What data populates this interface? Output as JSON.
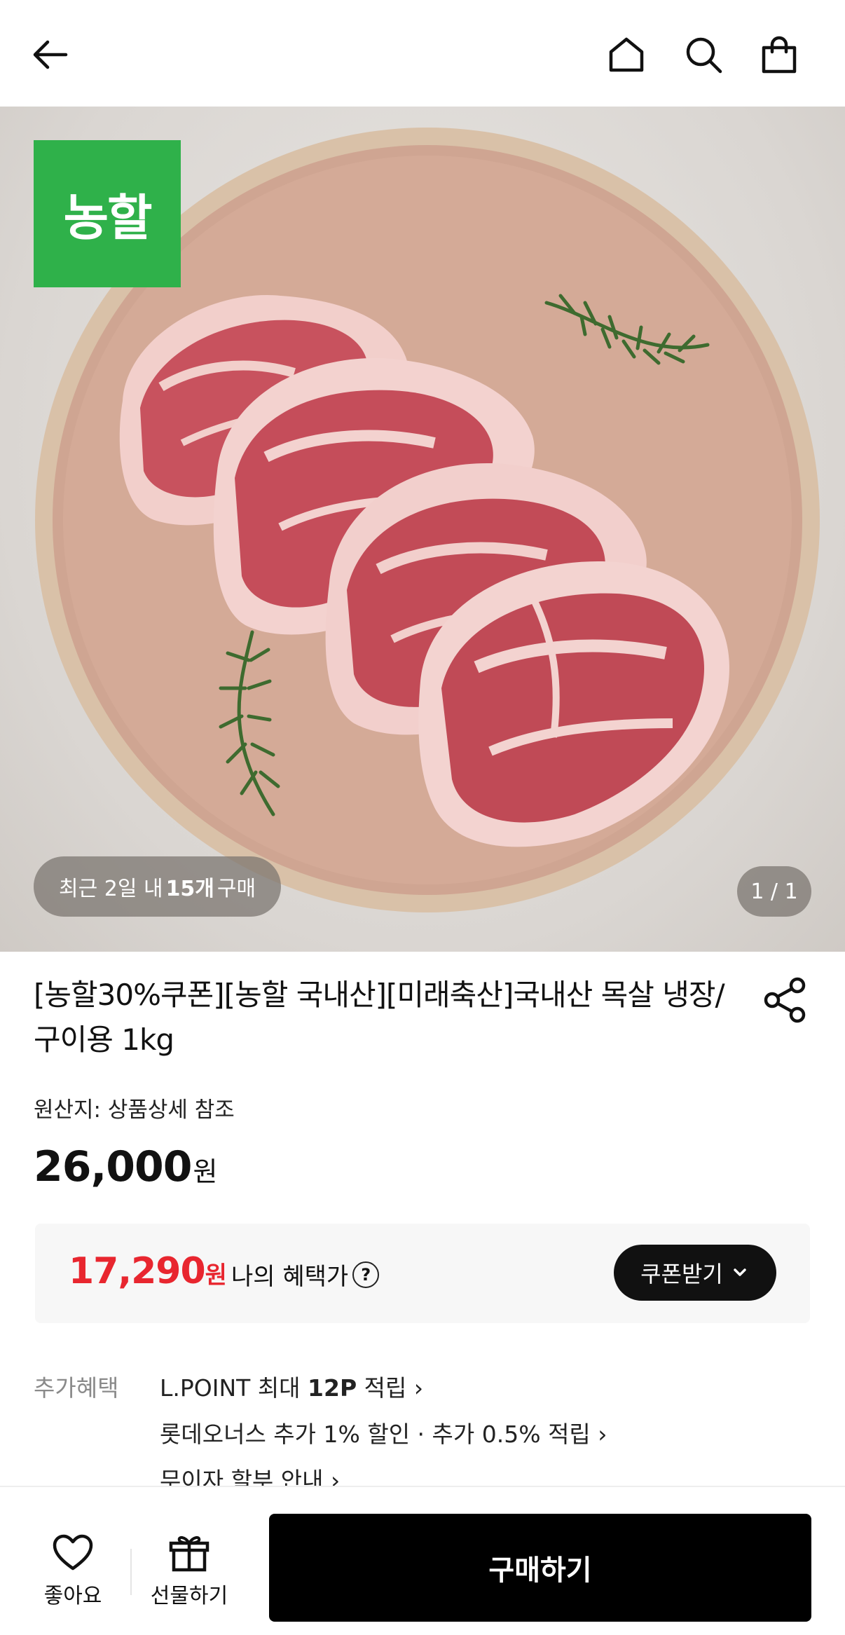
{
  "header": {
    "back_icon": "arrow-left-icon",
    "home_icon": "home-icon",
    "search_icon": "search-icon",
    "cart_icon": "shopping-bag-icon"
  },
  "hero": {
    "brand_badge": "농할",
    "recent_purchase": {
      "prefix": "최근 2일 내",
      "count": "15개",
      "suffix": "구매"
    },
    "page_indicator": "1 / 1"
  },
  "product": {
    "title": "[농할30%쿠폰][농할 국내산][미래축산]국내산 목살 냉장/구이용 1kg",
    "share_icon": "share-icon",
    "origin": "원산지: 상품상세 참조",
    "price": "26,000",
    "price_unit": "원"
  },
  "benefit": {
    "price": "17,290",
    "price_unit": "원",
    "label": "나의 혜택가",
    "help_icon": "question-circle-icon",
    "coupon_button": "쿠폰받기"
  },
  "extra_benefits": {
    "label": "추가혜택",
    "lines": [
      {
        "pre": "L.POINT 최대",
        "bold": "12P",
        "post": "적립"
      },
      {
        "pre": "롯데오너스 추가 1% 할인 · 추가 0.5% 적립",
        "bold": "",
        "post": ""
      },
      {
        "pre": "무이자 할부 안내",
        "bold": "",
        "post": ""
      }
    ]
  },
  "bottom_bar": {
    "like_label": "좋아요",
    "gift_label": "선물하기",
    "buy_label": "구매하기"
  },
  "colors": {
    "brand_green": "#2fb14a",
    "benefit_red": "#e8262f",
    "dark": "#111111"
  }
}
